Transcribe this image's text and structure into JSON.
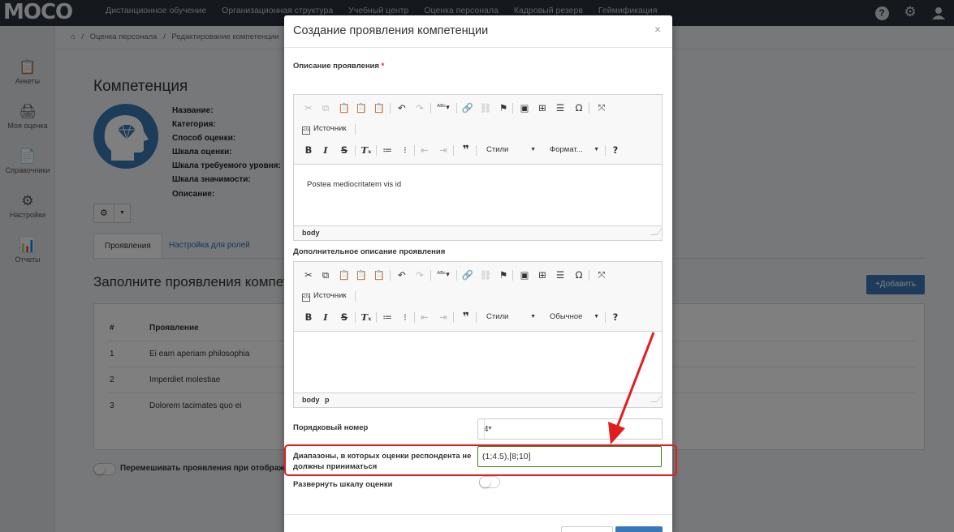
{
  "app": {
    "logo": "MOCO"
  },
  "topnav": [
    "Дистанционное обучение",
    "Организационная структура",
    "Учебный центр",
    "Оценка персонала",
    "Кадровый резерв",
    "Геймификация"
  ],
  "topbar_icons": {
    "help": "?",
    "settings": "⚙"
  },
  "sidebar": [
    {
      "label": "Анкеты",
      "icon": "📋"
    },
    {
      "label": "Моя оценка",
      "icon": "🖨"
    },
    {
      "label": "Справочники",
      "icon": "📄"
    },
    {
      "label": "Настройки",
      "icon": "⚙"
    },
    {
      "label": "Отчеты",
      "icon": "📊"
    }
  ],
  "breadcrumb": {
    "home": "⌂",
    "sep": "/",
    "items": [
      "Оценка персонала",
      "Редактирование компетенции"
    ]
  },
  "competence": {
    "title": "Компетенция",
    "fields": [
      "Название:",
      "Категория:",
      "Способ оценки:",
      "Шкала оценки:",
      "Шкала требуемого уровня:",
      "Шкала значимости:",
      "Описание:"
    ]
  },
  "tabs": [
    "Проявления",
    "Настройка для ролей"
  ],
  "manifestations": {
    "title": "Заполните проявления компете",
    "add_button": "+Добавить",
    "columns": [
      "#",
      "Проявление"
    ],
    "rows": [
      {
        "num": "1",
        "text": "Ei eam aperiam philosophia"
      },
      {
        "num": "2",
        "text": "Imperdiet molestiae"
      },
      {
        "num": "3",
        "text": "Dolorem tacimates quo ei"
      }
    ],
    "shuffle_label": "Перемешивать проявления при отображ"
  },
  "modal": {
    "title": "Создание проявления компетенции",
    "close": "×",
    "description_label": "Описание проявления",
    "required_mark": "*",
    "editor1": {
      "source_label": "Источник",
      "styles": "Стили",
      "format": "Формат...",
      "content": "Postea mediocritatem vis id",
      "path": [
        "body"
      ]
    },
    "additional_label": "Дополнительное описание проявления",
    "editor2": {
      "source_label": "Источник",
      "styles": "Стили",
      "format": "Обычное",
      "content": "",
      "path": [
        "body",
        "p"
      ]
    },
    "order_label": "Порядковый номер",
    "order_value": "4",
    "ranges_label_1": "Диапазоны, в которых оценки респондента не",
    "ranges_label_2": "должны приниматься",
    "ranges_value": "(1;4.5),[8;10]",
    "expand_label": "Развернуть шкалу оценки"
  },
  "colors": {
    "primary": "#3a77b6",
    "topbar": "#2b3138",
    "highlight": "#e21d1d",
    "input_valid": "#3d7a1f"
  }
}
